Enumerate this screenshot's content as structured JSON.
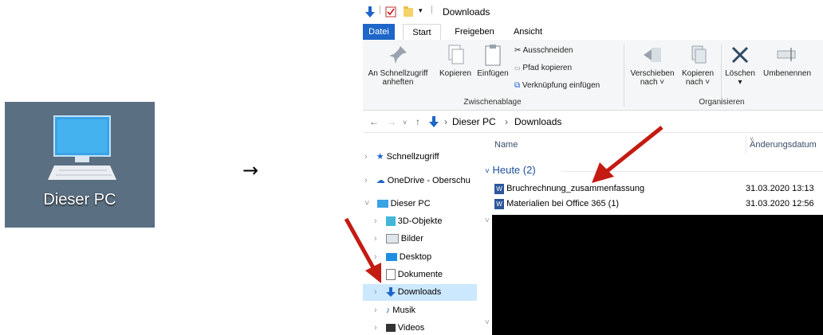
{
  "desktop_icon": {
    "label": "Dieser PC"
  },
  "transition_arrow": "→",
  "explorer": {
    "title": "Downloads",
    "tabs": [
      "Datei",
      "Start",
      "Freigeben",
      "Ansicht"
    ],
    "ribbon": {
      "pin_line1": "An Schnellzugriff",
      "pin_line2": "anheften",
      "copy": "Kopieren",
      "paste": "Einfügen",
      "cut": "Ausschneiden",
      "copy_path": "Pfad kopieren",
      "paste_shortcut": "Verknüpfung einfügen",
      "clipboard_group": "Zwischenablage",
      "move_line1": "Verschieben",
      "move_line2": "nach ˅",
      "copyto_line1": "Kopieren",
      "copyto_line2": "nach ˅",
      "delete": "Löschen",
      "rename": "Umbenennen",
      "organize_group": "Organisieren"
    },
    "address": {
      "root": "Dieser PC",
      "current": "Downloads"
    },
    "nav": [
      "Schnellzugriff",
      "OneDrive - Oberschu",
      "Dieser PC",
      "3D-Objekte",
      "Bilder",
      "Desktop",
      "Dokumente",
      "Downloads",
      "Musik",
      "Videos"
    ],
    "columns": {
      "name": "Name",
      "date": "Änderungsdatum"
    },
    "group_header": "Heute (2)",
    "files": [
      {
        "name": "Bruchrechnung_zusammenfassung",
        "date": "31.03.2020 13:13"
      },
      {
        "name": "Materialien bei Office 365 (1)",
        "date": "31.03.2020 12:56"
      }
    ]
  },
  "colors": {
    "accent": "#1e66c8",
    "selected_nav": "#cce8ff",
    "annotation_arrow": "#c41b12",
    "desktop_bg": "#5b6f82"
  }
}
